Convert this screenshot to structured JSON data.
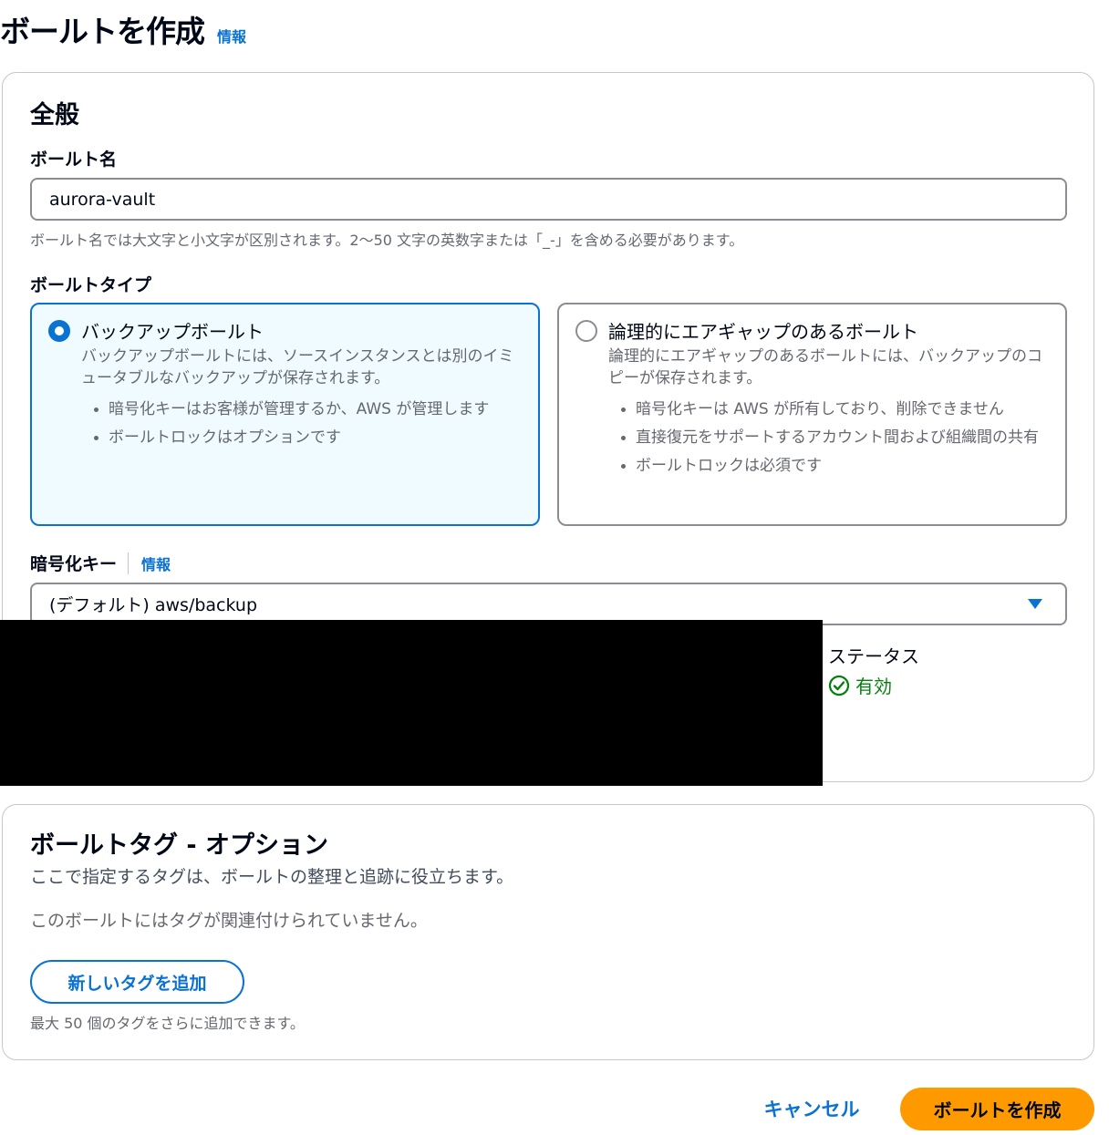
{
  "header": {
    "title": "ボールトを作成",
    "info_link": "情報"
  },
  "general": {
    "section_title": "全般",
    "vault_name": {
      "label": "ボールト名",
      "value": "aurora-vault",
      "hint": "ボールト名では大文字と小文字が区別されます。2～50 文字の英数字または「_-」を含める必要があります。"
    },
    "vault_type": {
      "label": "ボールトタイプ",
      "options": [
        {
          "title": "バックアップボールト",
          "description": "バックアップボールトには、ソースインスタンスとは別のイミュータブルなバックアップが保存されます。",
          "bullets": [
            "暗号化キーはお客様が管理するか、AWS が管理します",
            "ボールトロックはオプションです"
          ],
          "selected": true
        },
        {
          "title": "論理的にエアギャップのあるボールト",
          "description": "論理的にエアギャップのあるボールトには、バックアップのコピーが保存されます。",
          "bullets": [
            "暗号化キーは AWS が所有しており、削除できません",
            "直接復元をサポートするアカウント間および組織間の共有",
            "ボールトロックは必須です"
          ],
          "selected": false
        }
      ]
    },
    "encryption_key": {
      "label": "暗号化キー",
      "info_link": "情報",
      "selected_value": "(デフォルト) aws/backup"
    },
    "status": {
      "label": "ステータス",
      "value": "有効"
    }
  },
  "tags": {
    "section_title": "ボールトタグ - オプション",
    "description": "ここで指定するタグは、ボールトの整理と追跡に役立ちます。",
    "empty_message": "このボールトにはタグが関連付けられていません。",
    "add_button": "新しいタグを追加",
    "limit_hint": "最大 50 個のタグをさらに追加できます。"
  },
  "footer": {
    "cancel_label": "キャンセル",
    "create_label": "ボールトを作成"
  },
  "colors": {
    "accent": "#0972d3",
    "primary_button": "#ff9900",
    "success": "#037f0c",
    "selected_tile_bg": "#f0fbff"
  },
  "icons": {
    "status": "check-circle-icon",
    "select": "caret-down-icon"
  }
}
